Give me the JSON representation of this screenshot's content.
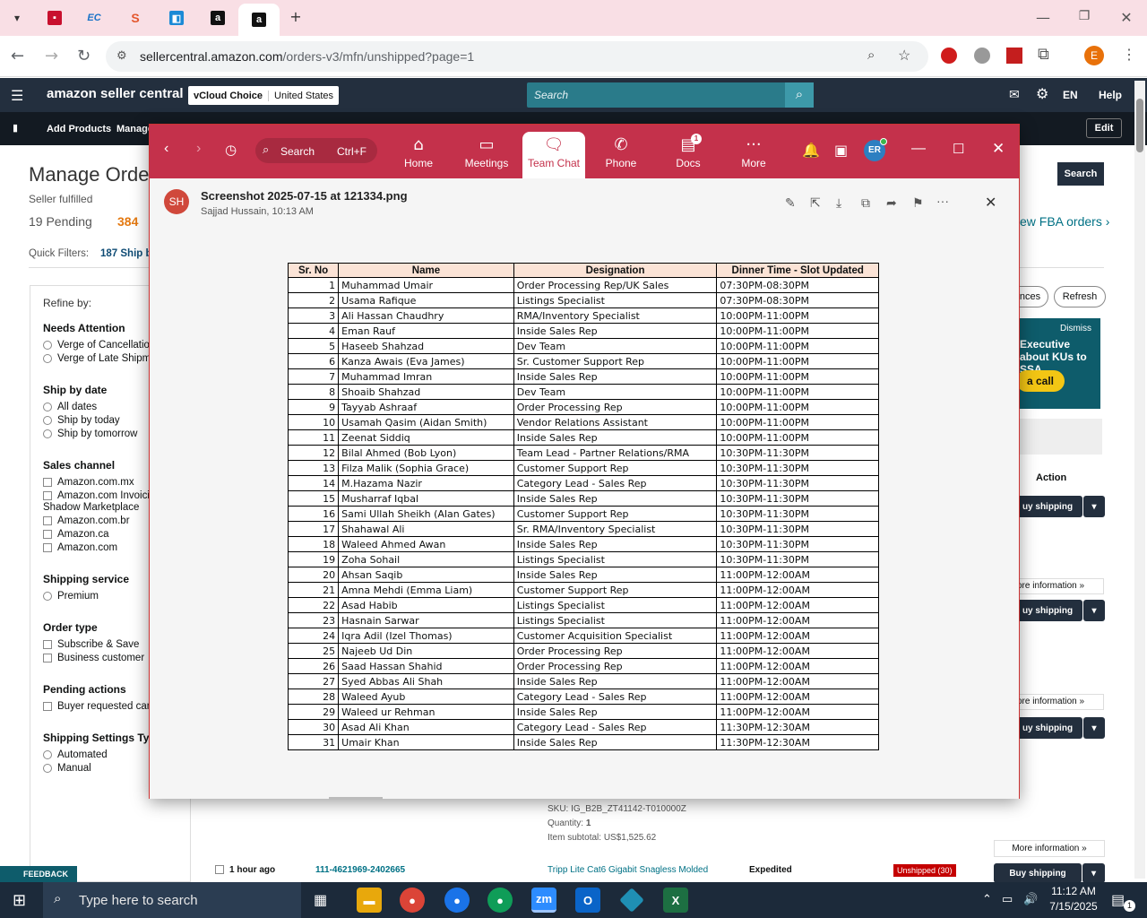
{
  "browser": {
    "url_host": "sellercentral.amazon.com",
    "url_path": "/orders-v3/mfn/unshipped?page=1",
    "profile_initial": "E"
  },
  "amazon": {
    "logo": "amazon seller central",
    "store": "vCloud Choice",
    "region": "United States",
    "search_placeholder": "Search",
    "lang": "EN",
    "help": "Help",
    "add_products": "Add Products",
    "manage": "Manage",
    "edit": "Edit",
    "page_title": "Manage Orde",
    "seller_fulfilled": "Seller fulfilled",
    "pending": "19 Pending",
    "count_384": "384",
    "quick_filters": "Quick Filters:",
    "quick_ship": "187 Ship b",
    "search_btn": "Search",
    "fba_link": "ew FBA orders ›",
    "refine_by": "Refine by:",
    "needs_attention": "Needs Attention",
    "na_opts": [
      "Verge of Cancellatio",
      "Verge of Late Shipm"
    ],
    "ship_by_date": "Ship by date",
    "sbd_opts": [
      "All dates",
      "Ship by today",
      "Ship by tomorrow"
    ],
    "sales_channel": "Sales channel",
    "sc_opts": [
      "Amazon.com.mx",
      "Amazon.com Invoici",
      "Amazon.com.br",
      "Amazon.ca",
      "Amazon.com"
    ],
    "shadow": "Shadow Marketplace",
    "shipping_service": "Shipping service",
    "ss_opts": [
      "Premium"
    ],
    "order_type": "Order type",
    "ot_opts": [
      "Subscribe & Save",
      "Business customer"
    ],
    "pending_actions": "Pending actions",
    "pa_opts": [
      "Buyer requested can"
    ],
    "shipping_settings": "Shipping Settings Type",
    "sst_opts": [
      "Automated",
      "Manual"
    ],
    "ances": "nces",
    "refresh": "Refresh",
    "dismiss": "Dismiss",
    "promo": "Executive about KUs to SSA",
    "promo_btn": "a call",
    "action": "Action",
    "buy_shipping_short": "uy shipping",
    "buy_shipping": "Buy shipping",
    "more_info_short": "ore information »",
    "more_info": "More information »",
    "sku": "SKU: IG_B2B_ZT41142-T010000Z",
    "quantity_label": "Quantity:",
    "quantity": "1",
    "subtotal_label": "Item subtotal:",
    "subtotal": "US$1,525.62",
    "row_time": "1 hour ago",
    "row_order": "111-4621969-2402665",
    "row_product": "Tripp Lite Cat6 Gigabit Snagless Molded",
    "row_service": "Expedited",
    "row_status": "Unshipped (30)",
    "feedback": "FEEDBACK"
  },
  "teams": {
    "search": "Search",
    "shortcut": "Ctrl+F",
    "nav": [
      {
        "label": "Home",
        "icon": "home-icon"
      },
      {
        "label": "Meetings",
        "icon": "video-icon"
      },
      {
        "label": "Team Chat",
        "icon": "chat-icon"
      },
      {
        "label": "Phone",
        "icon": "phone-icon"
      },
      {
        "label": "Docs",
        "icon": "docs-icon"
      },
      {
        "label": "More",
        "icon": "more-icon"
      }
    ],
    "docs_badge": "1",
    "avatar": "ER",
    "file_avatar": "SH",
    "file_name": "Screenshot 2025-07-15 at 121334.png",
    "file_meta": "Sajjad Hussain, 10:13 AM"
  },
  "table": {
    "headers": [
      "Sr. No",
      "Name",
      "Designation",
      "Dinner Time - Slot Updated"
    ],
    "rows": [
      [
        "1",
        "Muhammad Umair",
        "Order Processing Rep/UK Sales",
        "07:30PM-08:30PM"
      ],
      [
        "2",
        "Usama Rafique",
        "Listings Specialist",
        "07:30PM-08:30PM"
      ],
      [
        "3",
        "Ali Hassan Chaudhry",
        "RMA/Inventory Specialist",
        "10:00PM-11:00PM"
      ],
      [
        "4",
        "Eman Rauf",
        "Inside Sales Rep",
        "10:00PM-11:00PM"
      ],
      [
        "5",
        "Haseeb Shahzad",
        "Dev Team",
        "10:00PM-11:00PM"
      ],
      [
        "6",
        "Kanza Awais (Eva James)",
        "Sr. Customer Support Rep",
        "10:00PM-11:00PM"
      ],
      [
        "7",
        "Muhammad Imran",
        "Inside Sales Rep",
        "10:00PM-11:00PM"
      ],
      [
        "8",
        "Shoaib Shahzad",
        "Dev Team",
        "10:00PM-11:00PM"
      ],
      [
        "9",
        "Tayyab Ashraaf",
        "Order Processing Rep",
        "10:00PM-11:00PM"
      ],
      [
        "10",
        "Usamah Qasim (Aidan Smith)",
        "Vendor Relations Assistant",
        "10:00PM-11:00PM"
      ],
      [
        "11",
        "Zeenat Siddiq",
        "Inside Sales Rep",
        "10:00PM-11:00PM"
      ],
      [
        "12",
        "Bilal Ahmed (Bob Lyon)",
        "Team Lead - Partner Relations/RMA",
        "10:30PM-11:30PM"
      ],
      [
        "13",
        "Filza Malik (Sophia Grace)",
        "Customer Support Rep",
        "10:30PM-11:30PM"
      ],
      [
        "14",
        "M.Hazama Nazir",
        "Category Lead - Sales Rep",
        "10:30PM-11:30PM"
      ],
      [
        "15",
        "Musharraf Iqbal",
        "Inside Sales Rep",
        "10:30PM-11:30PM"
      ],
      [
        "16",
        "Sami Ullah Sheikh (Alan Gates)",
        "Customer Support Rep",
        "10:30PM-11:30PM"
      ],
      [
        "17",
        "Shahawal Ali",
        "Sr. RMA/Inventory Specialist",
        "10:30PM-11:30PM"
      ],
      [
        "18",
        "Waleed Ahmed Awan",
        "Inside Sales Rep",
        "10:30PM-11:30PM"
      ],
      [
        "19",
        "Zoha Sohail",
        "Listings Specialist",
        "10:30PM-11:30PM"
      ],
      [
        "20",
        "Ahsan Saqib",
        "Inside Sales Rep",
        "11:00PM-12:00AM"
      ],
      [
        "21",
        "Amna Mehdi (Emma Liam)",
        "Customer Support Rep",
        "11:00PM-12:00AM"
      ],
      [
        "22",
        "Asad Habib",
        "Listings Specialist",
        "11:00PM-12:00AM"
      ],
      [
        "23",
        "Hasnain Sarwar",
        "Listings Specialist",
        "11:00PM-12:00AM"
      ],
      [
        "24",
        "Iqra Adil (Izel Thomas)",
        "Customer Acquisition Specialist",
        "11:00PM-12:00AM"
      ],
      [
        "25",
        "Najeeb Ud Din",
        "Order Processing Rep",
        "11:00PM-12:00AM"
      ],
      [
        "26",
        "Saad Hassan Shahid",
        "Order Processing Rep",
        "11:00PM-12:00AM"
      ],
      [
        "27",
        "Syed Abbas Ali Shah",
        "Inside Sales Rep",
        "11:00PM-12:00AM"
      ],
      [
        "28",
        "Waleed Ayub",
        "Category Lead - Sales Rep",
        "11:00PM-12:00AM"
      ],
      [
        "29",
        "Waleed ur Rehman",
        "Inside Sales Rep",
        "11:00PM-12:00AM"
      ],
      [
        "30",
        "Asad Ali Khan",
        "Category Lead - Sales Rep",
        "11:30PM-12:30AM"
      ],
      [
        "31",
        "Umair Khan",
        "Inside Sales Rep",
        "11:30PM-12:30AM"
      ]
    ]
  },
  "taskbar": {
    "search_placeholder": "Type here to search",
    "time": "11:12 AM",
    "date": "7/15/2025",
    "notif_count": "1"
  },
  "colors": {
    "teams_red": "#c4314b",
    "amazon_dark": "#232f3e",
    "amazon_teal": "#007185"
  }
}
